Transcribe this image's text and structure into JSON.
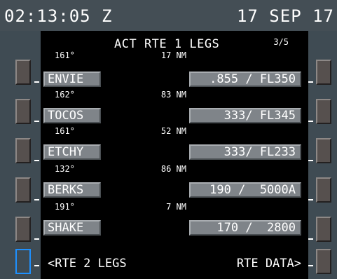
{
  "status_bar": {
    "time": "02:13:05 Z",
    "date": "17 SEP 17"
  },
  "cdu": {
    "title": "ACT RTE 1 LEGS",
    "page": "3/5",
    "legs": [
      {
        "course": "161°",
        "distance": "17 NM",
        "waypoint": "ENVIE",
        "constraint": ".855 / FL350"
      },
      {
        "course": "162°",
        "distance": "83 NM",
        "waypoint": "TOCOS",
        "constraint": "333/ FL345"
      },
      {
        "course": "161°",
        "distance": "52 NM",
        "waypoint": "ETCHY",
        "constraint": "333/ FL233"
      },
      {
        "course": "132°",
        "distance": "86 NM",
        "waypoint": "BERKS",
        "constraint": "190 /  5000A"
      },
      {
        "course": "191°",
        "distance": "7 NM",
        "waypoint": "SHAKE",
        "constraint": "170 /  2800"
      }
    ],
    "left_prompt": "<RTE 2 LEGS",
    "right_prompt": "RTE DATA>"
  },
  "colors": {
    "accent_selected": "#1e90ff",
    "screen_bg": "#000000",
    "bezel": "#3f4b53"
  }
}
